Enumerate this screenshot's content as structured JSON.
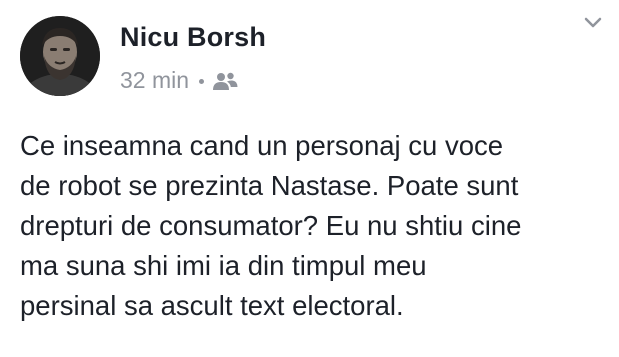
{
  "post": {
    "author": "Nicu Borsh",
    "timestamp": "32 min",
    "audience_icon": "friends-icon",
    "menu_icon": "chevron-down-icon",
    "text_lines": [
      "Ce inseamna cand un personaj cu voce",
      "de robot se prezinta Nastase. Poate sunt",
      "drepturi de consumator? Eu nu shtiu cine",
      "ma suna shi imi ia din timpul meu",
      "persinal sa ascult text electoral."
    ]
  },
  "colors": {
    "name": "#1d2129",
    "meta": "#90949c",
    "text": "#1d2129",
    "background": "#ffffff"
  }
}
